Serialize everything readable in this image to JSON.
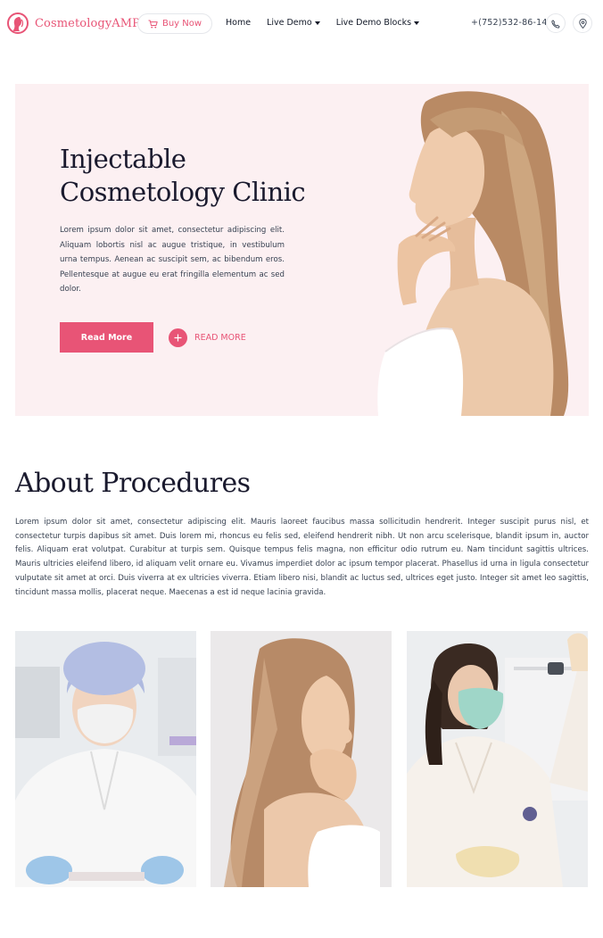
{
  "header": {
    "logo_text": "CosmetologyAMP",
    "buy_label": "Buy Now",
    "nav": [
      {
        "label": "Home",
        "dropdown": false
      },
      {
        "label": "Live Demo",
        "dropdown": true
      },
      {
        "label": "Live Demo Blocks",
        "dropdown": true
      }
    ],
    "phone": "+(752)532-86-14",
    "icons": {
      "logo": "woman-face-logo-icon",
      "cart": "cart-icon",
      "phone": "phone-icon",
      "location": "location-pin-icon"
    }
  },
  "hero": {
    "title_line1": "Injectable",
    "title_line2": "Cosmetology Clinic",
    "description": "Lorem ipsum dolor sit amet, consectetur adipiscing elit. Aliquam lobortis nisl ac augue tristique, in vestibulum urna tempus. Aenean ac suscipit sem, ac bibendum eros. Pellentesque at augue eu erat fringilla elementum ac sed dolor.",
    "primary_button": "Read More",
    "secondary_link": "READ MORE"
  },
  "about": {
    "title": "About Procedures",
    "text": "Lorem ipsum dolor sit amet, consectetur adipiscing elit. Mauris laoreet faucibus massa sollicitudin hendrerit. Integer suscipit purus nisl, et consectetur turpis dapibus sit amet. Duis lorem mi, rhoncus eu felis sed, eleifend hendrerit nibh. Ut non arcu scelerisque, blandit ipsum in, auctor felis. Aliquam erat volutpat. Curabitur at turpis sem. Quisque tempus felis magna, non efficitur odio rutrum eu. Nam tincidunt sagittis ultrices. Mauris ultricies eleifend libero, id aliquam velit ornare eu. Vivamus imperdiet dolor ac ipsum tempor placerat. Phasellus id urna in ligula consectetur vulputate sit amet at orci. Duis viverra at ex ultricies viverra. Etiam libero nisi, blandit ac luctus sed, ultrices eget justo. Integer sit amet leo sagittis, tincidunt massa mollis, placerat neque. Maecenas a est id neque lacinia gravida."
  },
  "colors": {
    "accent": "#e85476",
    "hero_bg": "#fcf0f2",
    "heading": "#1a1a2e"
  }
}
